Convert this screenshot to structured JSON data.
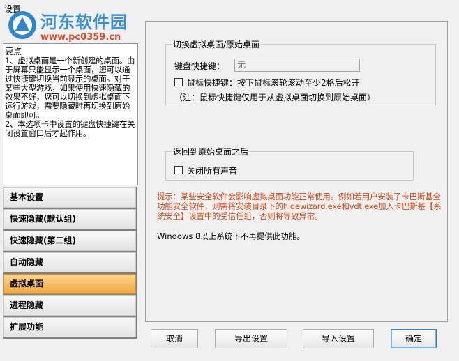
{
  "window": {
    "title": "设置"
  },
  "watermark": {
    "name": "河东软件园",
    "url": "www.pc0359.cn"
  },
  "help": {
    "title": "要点",
    "text": "1、虚拟桌面是一个新创建的桌面。由于屏幕只能显示一个桌面，您可以通过快捷键切换当前显示的桌面。对于某些大型游戏，如果使用快速隐藏的效果不好，您可以切换到虚拟桌面下运行游戏，需要隐藏时再切换到原始桌面即可。\n2、本选项卡中设置的键盘快捷键在关闭设置窗口后才起作用。"
  },
  "nav": {
    "items": [
      {
        "label": "基本设置",
        "active": false
      },
      {
        "label": "快速隐藏(默认组)",
        "active": false
      },
      {
        "label": "快速隐藏(第二组)",
        "active": false
      },
      {
        "label": "自动隐藏",
        "active": false
      },
      {
        "label": "虚拟桌面",
        "active": true
      },
      {
        "label": "进程隐藏",
        "active": false
      },
      {
        "label": "扩展功能",
        "active": false
      }
    ]
  },
  "switch_group": {
    "title": "切换虚拟桌面/原始桌面",
    "hotkey_label": "键盘快捷键：",
    "hotkey_value": "无",
    "mouse_label": "鼠标快捷键：按下鼠标滚轮滚动至少2格后松开",
    "note": "（注：鼠标快捷键仅用于从虚拟桌面切换到原始桌面）"
  },
  "return_group": {
    "title": "返回到原始桌面之后",
    "mute_label": "关闭所有声音"
  },
  "warning": "提示：某些安全软件会影响虚拟桌面功能正常使用。例如若用户安装了卡巴斯基全功能安全软件，则需将安装目录下的hidewizard.exe和vdt.exe加入卡巴斯基【系统安全】设置中的受信任组，否则将导致异常。",
  "os_note": "Windows 8以上系统下不再提供此功能。",
  "buttons": {
    "cancel": "取消",
    "export": "导出设置",
    "import": "导入设置",
    "ok": "确定"
  }
}
